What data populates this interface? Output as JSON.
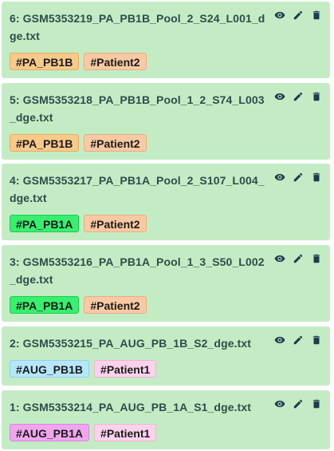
{
  "files": [
    {
      "title": "6: GSM5353219_PA_PB1B_Pool_2_S24_L001_dge.txt",
      "tags": [
        "#PA_PB1B",
        "#Patient2"
      ],
      "tag_colors": [
        "#f9c98a",
        "#f8c9a3"
      ]
    },
    {
      "title": "5: GSM5353218_PA_PB1B_Pool_1_2_S74_L003_dge.txt",
      "tags": [
        "#PA_PB1B",
        "#Patient2"
      ],
      "tag_colors": [
        "#f9c98a",
        "#f8c9a3"
      ]
    },
    {
      "title": "4: GSM5353217_PA_PB1A_Pool_2_S107_L004_dge.txt",
      "tags": [
        "#PA_PB1A",
        "#Patient2"
      ],
      "tag_colors": [
        "#36f06e",
        "#f8c9a3"
      ]
    },
    {
      "title": "3: GSM5353216_PA_PB1A_Pool_1_3_S50_L002_dge.txt",
      "tags": [
        "#PA_PB1A",
        "#Patient2"
      ],
      "tag_colors": [
        "#36f06e",
        "#f8c9a3"
      ]
    },
    {
      "title": "2: GSM5353215_PA_AUG_PB_1B_S2_dge.txt",
      "tags": [
        "#AUG_PB1B",
        "#Patient1"
      ],
      "tag_colors": [
        "#b6e6fb",
        "#fbd2ec"
      ]
    },
    {
      "title": "1: GSM5353214_PA_AUG_PB_1A_S1_dge.txt",
      "tags": [
        "#AUG_PB1A",
        "#Patient1"
      ],
      "tag_colors": [
        "#f0a6ee",
        "#fbd2ec"
      ]
    }
  ],
  "actions": [
    "eye-icon",
    "pencil-icon",
    "trash-icon"
  ],
  "colors": {
    "item_background": "#c4ecc4",
    "title_text": "#2d4d4c",
    "icon": "#1f3a52"
  }
}
